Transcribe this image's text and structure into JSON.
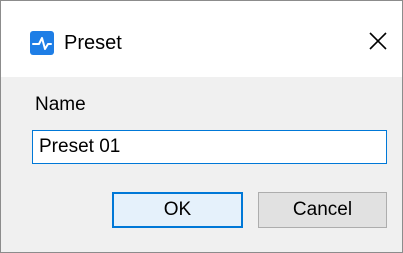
{
  "window": {
    "title": "Preset",
    "app_icon": "app-logo-icon",
    "close_icon": "close-icon"
  },
  "form": {
    "name_label": "Name",
    "name_value": "Preset 01"
  },
  "buttons": {
    "ok_label": "OK",
    "cancel_label": "Cancel"
  },
  "colors": {
    "accent": "#0078d7",
    "app_icon": "#1e7ee6",
    "dialog_background": "#f0f0f0",
    "titlebar_background": "#ffffff",
    "button_background": "#e1e1e1"
  }
}
